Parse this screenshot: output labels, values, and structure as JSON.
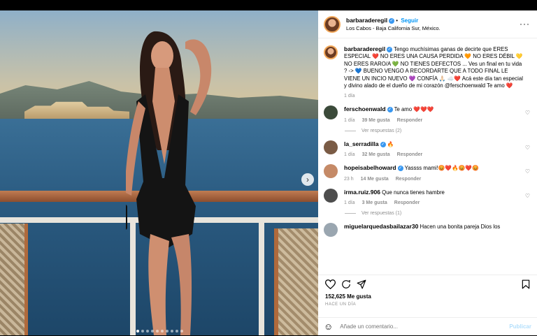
{
  "post": {
    "username": "barbaraderegil",
    "follow_label": "Seguir",
    "location": "Los Cabos - Baja California Sur, México.",
    "more_label": "···"
  },
  "caption": {
    "username": "barbaraderegil",
    "text": "Tengo muchísimas ganas de decirte que ERES ESPECIAL ❤️ NO ERES UNA CAUSA PERDIDA 🧡 NO ERES DÉBIL 💛 NO ERES RARO/A 💚 NO TIENES DEFECTOS ... Ves un final en tu vida ? -> 💙 BUENO VENGO A RECORDARTE QUE A TODO FINAL LE VIENE UN INCIO NUEVO 💜 CONFÍA 🙏🏻 ☁️❤️ Acá este día tan especial y divino alado de el dueño de mi corazón @ferschoenwald Te amo ❤️",
    "time": "1 día"
  },
  "comments": [
    {
      "user": "ferschoenwald",
      "verified": true,
      "text": "Te amo ❤️❤️❤️",
      "time": "1 día",
      "likes": "39 Me gusta",
      "reply": "Responder",
      "replies": "Ver respuestas (2)",
      "avatar_color": "#3b4a3a"
    },
    {
      "user": "la_serradilla",
      "verified": true,
      "text": "🔥",
      "time": "1 día",
      "likes": "32 Me gusta",
      "reply": "Responder",
      "replies": "",
      "avatar_color": "#7a5b45"
    },
    {
      "user": "hopeisabelhoward",
      "verified": true,
      "text": "Yassss mami!😡❤️🔥😡❤️😡",
      "time": "23 h",
      "likes": "14 Me gusta",
      "reply": "Responder",
      "replies": "",
      "avatar_color": "#c58a67"
    },
    {
      "user": "irma.ruiz.906",
      "verified": false,
      "text": "Que nunca tienes hambre",
      "time": "1 día",
      "likes": "3 Me gusta",
      "reply": "Responder",
      "replies": "Ver respuestas (1)",
      "avatar_color": "#4d4d4d"
    },
    {
      "user": "miguelarquedasbailazar30",
      "verified": false,
      "text": "Hacen una bonita pareja Dios los",
      "time": "",
      "likes": "",
      "reply": "",
      "replies": "",
      "avatar_color": "#9aa6b0"
    }
  ],
  "actions": {
    "likes": "152,625 Me gusta",
    "ago": "HACE UN DÍA"
  },
  "composer": {
    "placeholder": "Añade un comentario...",
    "publish": "Publicar"
  },
  "carousel": {
    "count": 10,
    "active": 0
  }
}
